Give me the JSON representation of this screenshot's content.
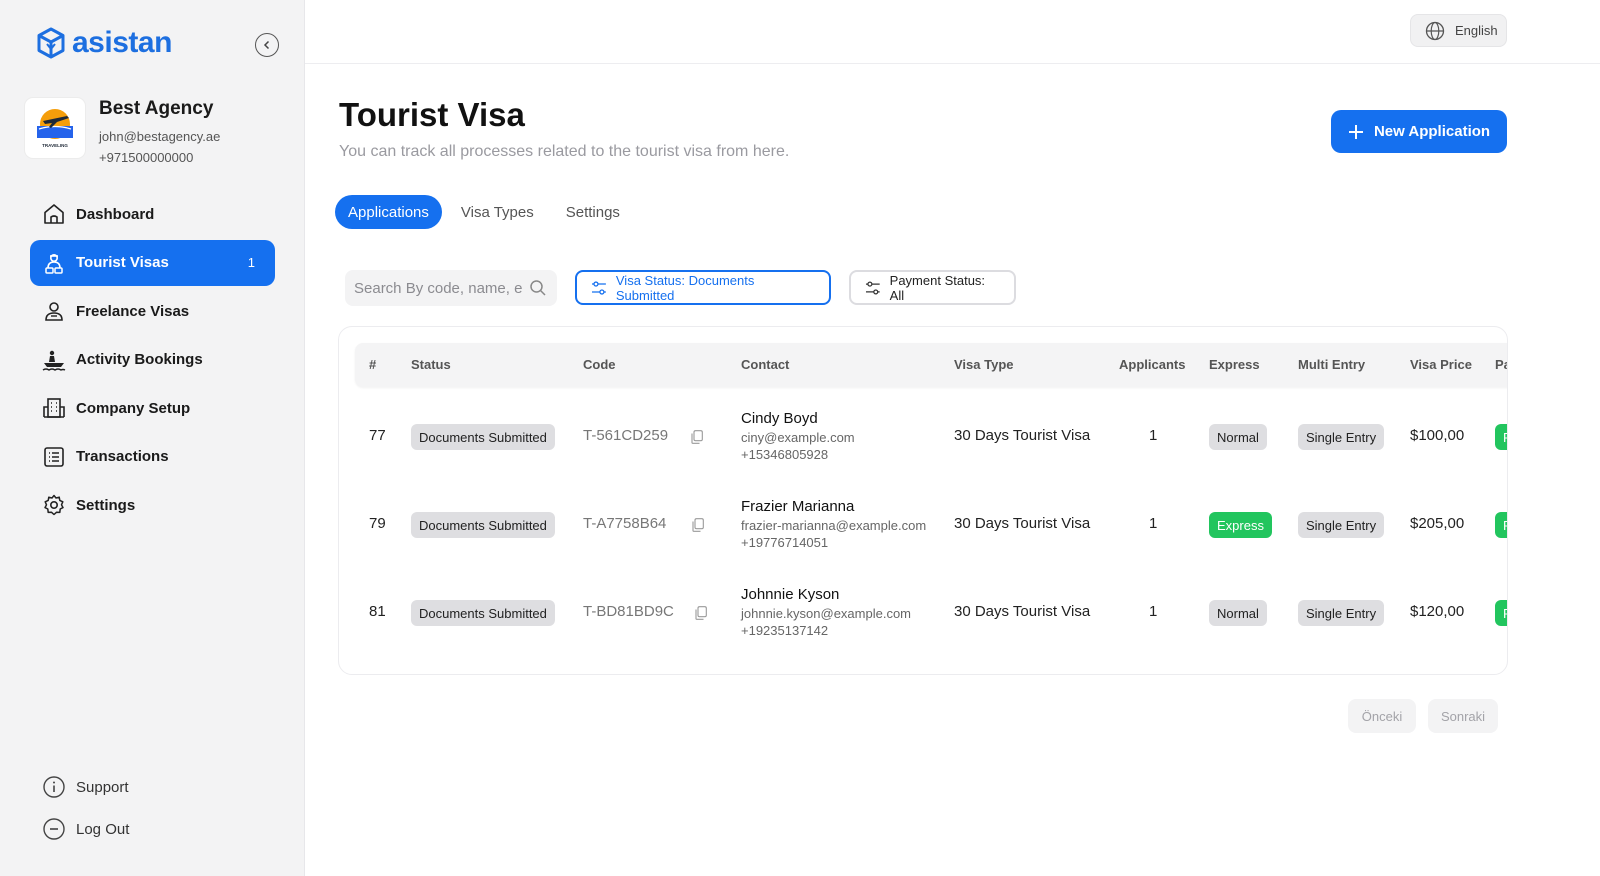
{
  "brand": {
    "name": "asistan",
    "color": "#1d6fe0"
  },
  "agency": {
    "name": "Best Agency",
    "email": "john@bestagency.ae",
    "phone": "+971500000000",
    "logo_caption": "TRAVELING"
  },
  "nav": {
    "items": [
      {
        "label": "Dashboard",
        "icon": "home-icon"
      },
      {
        "label": "Tourist Visas",
        "icon": "traveler-icon",
        "badge": "1",
        "active": true
      },
      {
        "label": "Freelance Visas",
        "icon": "user-icon"
      },
      {
        "label": "Activity Bookings",
        "icon": "boat-icon"
      },
      {
        "label": "Company Setup",
        "icon": "building-icon"
      },
      {
        "label": "Transactions",
        "icon": "list-icon"
      },
      {
        "label": "Settings",
        "icon": "gear-icon"
      }
    ],
    "bottom": [
      {
        "label": "Support",
        "icon": "info-icon"
      },
      {
        "label": "Log Out",
        "icon": "minus-circle-icon"
      }
    ]
  },
  "topbar": {
    "language": "English"
  },
  "page": {
    "title": "Tourist Visa",
    "subtitle": "You can track all processes related to the tourist visa from here.",
    "new_button": "New Application"
  },
  "tabs": [
    "Applications",
    "Visa Types",
    "Settings"
  ],
  "filters": {
    "search_placeholder": "Search By code, name, e",
    "visa_status": "Visa Status: Documents Submitted",
    "payment_status": "Payment Status: All"
  },
  "table": {
    "headers": [
      "#",
      "Status",
      "Code",
      "Contact",
      "Visa Type",
      "Applicants",
      "Express",
      "Multi Entry",
      "Visa Price",
      "Pa"
    ],
    "rows": [
      {
        "id": "77",
        "status": "Documents Submitted",
        "code": "T-561CD259",
        "name": "Cindy Boyd",
        "email": "ciny@example.com",
        "phone": "+15346805928",
        "visa_type": "30 Days Tourist Visa",
        "applicants": "1",
        "express": "Normal",
        "is_express": false,
        "multi_entry": "Single Entry",
        "price": "$100,00",
        "payment": "P"
      },
      {
        "id": "79",
        "status": "Documents Submitted",
        "code": "T-A7758B64",
        "name": "Frazier Marianna",
        "email": "frazier-marianna@example.com",
        "phone": "+19776714051",
        "visa_type": "30 Days Tourist Visa",
        "applicants": "1",
        "express": "Express",
        "is_express": true,
        "multi_entry": "Single Entry",
        "price": "$205,00",
        "payment": "P"
      },
      {
        "id": "81",
        "status": "Documents Submitted",
        "code": "T-BD81BD9C",
        "name": "Johnnie Kyson",
        "email": "johnnie.kyson@example.com",
        "phone": "+19235137142",
        "visa_type": "30 Days Tourist Visa",
        "applicants": "1",
        "express": "Normal",
        "is_express": false,
        "multi_entry": "Single Entry",
        "price": "$120,00",
        "payment": "P"
      }
    ]
  },
  "pagination": {
    "prev": "Önceki",
    "next": "Sonraki"
  },
  "colors": {
    "primary": "#1570ef",
    "success": "#22c55e",
    "sidebar_bg": "#f3f3f4"
  }
}
